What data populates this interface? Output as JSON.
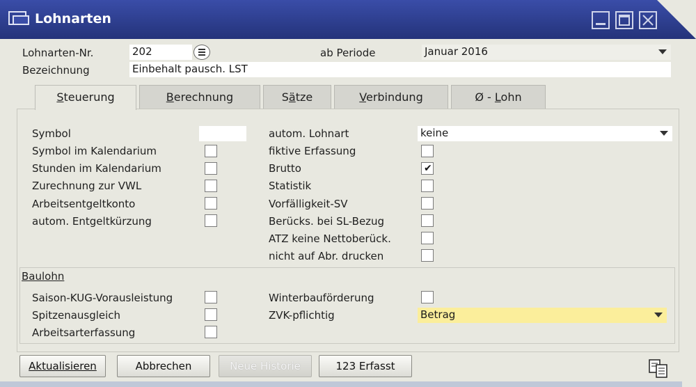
{
  "window": {
    "title": "Lohnarten"
  },
  "header": {
    "nr_label": "Lohnarten-Nr.",
    "nr_value": "202",
    "periode_label": "ab Periode",
    "periode_value": "Januar 2016",
    "bezeichnung_label": "Bezeichnung",
    "bezeichnung_value": "Einbehalt pausch. LST"
  },
  "tabs": [
    {
      "label_pre": "",
      "label_u": "S",
      "label_post": "teuerung",
      "active": true
    },
    {
      "label_pre": "",
      "label_u": "B",
      "label_post": "erechnung",
      "active": false
    },
    {
      "label_pre": "S",
      "label_u": "ä",
      "label_post": "tze",
      "active": false
    },
    {
      "label_pre": "",
      "label_u": "V",
      "label_post": "erbindung",
      "active": false
    },
    {
      "label_pre": "Ø - ",
      "label_u": "L",
      "label_post": "ohn",
      "active": false
    }
  ],
  "left_col": {
    "symbol_label": "Symbol",
    "symbol_value": "",
    "items": [
      {
        "label": "Symbol im Kalendarium",
        "checked": false
      },
      {
        "label": "Stunden im Kalendarium",
        "checked": false
      },
      {
        "label": "Zurechnung zur VWL",
        "checked": false
      },
      {
        "label": "Arbeitsentgeltkonto",
        "checked": false
      },
      {
        "label": "autom. Entgeltkürzung",
        "checked": false
      }
    ]
  },
  "right_col": {
    "lohnart_label": "autom. Lohnart",
    "lohnart_value": "keine",
    "items": [
      {
        "label": "fiktive Erfassung",
        "checked": false
      },
      {
        "label": "Brutto",
        "checked": true
      },
      {
        "label": "Statistik",
        "checked": false
      },
      {
        "label": "Vorfälligkeit-SV",
        "checked": false
      },
      {
        "label": "Berücks. bei SL-Bezug",
        "checked": false
      },
      {
        "label": "ATZ keine Nettoberück.",
        "checked": false
      },
      {
        "label": "nicht auf Abr. drucken",
        "checked": false
      }
    ]
  },
  "baulohn": {
    "heading": "Baulohn",
    "left": [
      {
        "label": "Saison-KUG-Vorausleistung",
        "checked": false
      },
      {
        "label": "Spitzenausgleich",
        "checked": false
      },
      {
        "label": "Arbeitsarterfassung",
        "checked": false
      }
    ],
    "winter_label": "Winterbauförderung",
    "winter_checked": false,
    "zvk_label": "ZVK-pflichtig",
    "zvk_value": "Betrag"
  },
  "buttons": {
    "aktualisieren": "Aktualisieren",
    "abbrechen": "Abbrechen",
    "neue_historie": "Neue Historie",
    "erfasst": "123 Erfasst"
  },
  "check_glyph": "✔"
}
